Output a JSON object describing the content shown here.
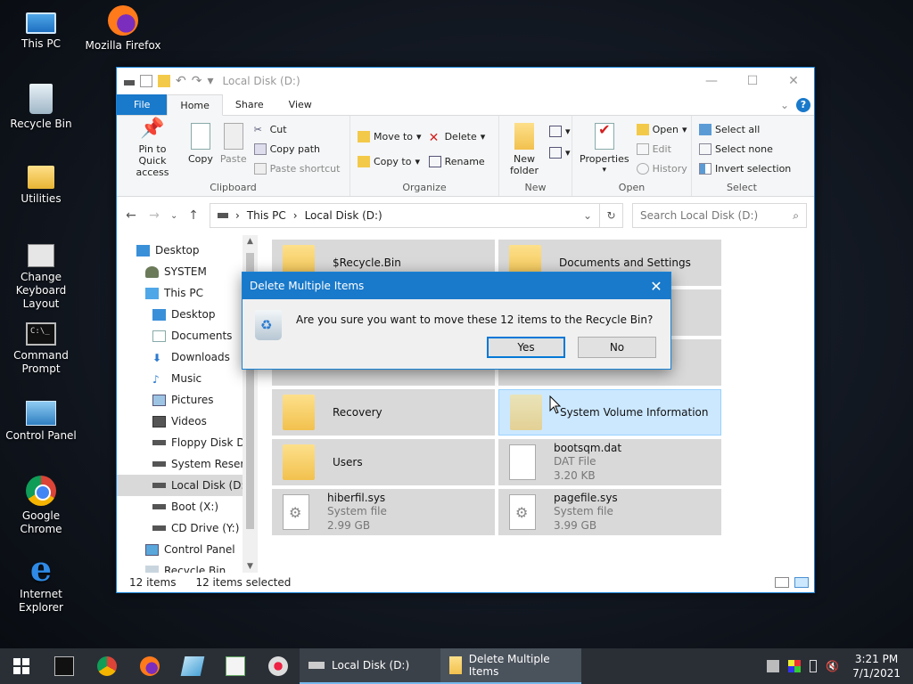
{
  "desktop": {
    "icons": [
      {
        "label": "This PC"
      },
      {
        "label": "Mozilla Firefox"
      },
      {
        "label": "Recycle Bin"
      },
      {
        "label": "Utilities"
      },
      {
        "label": "Change Keyboard Layout"
      },
      {
        "label": "Command Prompt"
      },
      {
        "label": "Control Panel"
      },
      {
        "label": "Google Chrome"
      },
      {
        "label": "Internet Explorer"
      }
    ]
  },
  "explorer": {
    "title": "Local Disk (D:)",
    "tabs": {
      "file": "File",
      "home": "Home",
      "share": "Share",
      "view": "View"
    },
    "ribbon": {
      "clipboard": {
        "label": "Clipboard",
        "pin": "Pin to Quick access",
        "copy": "Copy",
        "paste": "Paste",
        "cut": "Cut",
        "copy_path": "Copy path",
        "paste_shortcut": "Paste shortcut"
      },
      "organize": {
        "label": "Organize",
        "move_to": "Move to",
        "copy_to": "Copy to",
        "delete": "Delete",
        "rename": "Rename"
      },
      "new": {
        "label": "New",
        "new_folder": "New folder"
      },
      "open": {
        "label": "Open",
        "properties": "Properties",
        "open": "Open",
        "edit": "Edit",
        "history": "History"
      },
      "select": {
        "label": "Select",
        "select_all": "Select all",
        "select_none": "Select none",
        "invert": "Invert selection"
      }
    },
    "address": {
      "crumb1": "This PC",
      "crumb2": "Local Disk (D:)"
    },
    "search": {
      "placeholder": "Search Local Disk (D:)"
    },
    "nav_tree": [
      {
        "label": "Desktop"
      },
      {
        "label": "SYSTEM"
      },
      {
        "label": "This PC"
      },
      {
        "label": "Desktop"
      },
      {
        "label": "Documents"
      },
      {
        "label": "Downloads"
      },
      {
        "label": "Music"
      },
      {
        "label": "Pictures"
      },
      {
        "label": "Videos"
      },
      {
        "label": "Floppy Disk Dri"
      },
      {
        "label": "System Reserve"
      },
      {
        "label": "Local Disk (D:)"
      },
      {
        "label": "Boot (X:)"
      },
      {
        "label": "CD Drive (Y:) H"
      },
      {
        "label": "Control Panel"
      },
      {
        "label": "Recycle Bin"
      }
    ],
    "files": [
      {
        "name": "$Recycle.Bin",
        "type": "",
        "size": ""
      },
      {
        "name": "Documents and Settings",
        "type": "",
        "size": ""
      },
      {
        "name": "Recovery",
        "type": "",
        "size": ""
      },
      {
        "name": "System Volume Information",
        "type": "",
        "size": ""
      },
      {
        "name": "Users",
        "type": "",
        "size": ""
      },
      {
        "name": "bootsqm.dat",
        "type": "DAT File",
        "size": "3.20 KB"
      },
      {
        "name": "hiberfil.sys",
        "type": "System file",
        "size": "2.99 GB"
      },
      {
        "name": "pagefile.sys",
        "type": "System file",
        "size": "3.99 GB"
      }
    ],
    "status": {
      "count": "12 items",
      "selected": "12 items selected"
    }
  },
  "dialog": {
    "title": "Delete Multiple Items",
    "message": "Are you sure you want to move these 12 items to the Recycle Bin?",
    "yes": "Yes",
    "no": "No"
  },
  "taskbar": {
    "tasks": [
      {
        "label": "Local Disk (D:)"
      },
      {
        "label": "Delete Multiple Items"
      }
    ],
    "time": "3:21 PM",
    "date": "7/1/2021"
  },
  "colors": {
    "accent": "#1979ca",
    "selection": "#cce8ff",
    "taskbar": "#2a2f36"
  }
}
